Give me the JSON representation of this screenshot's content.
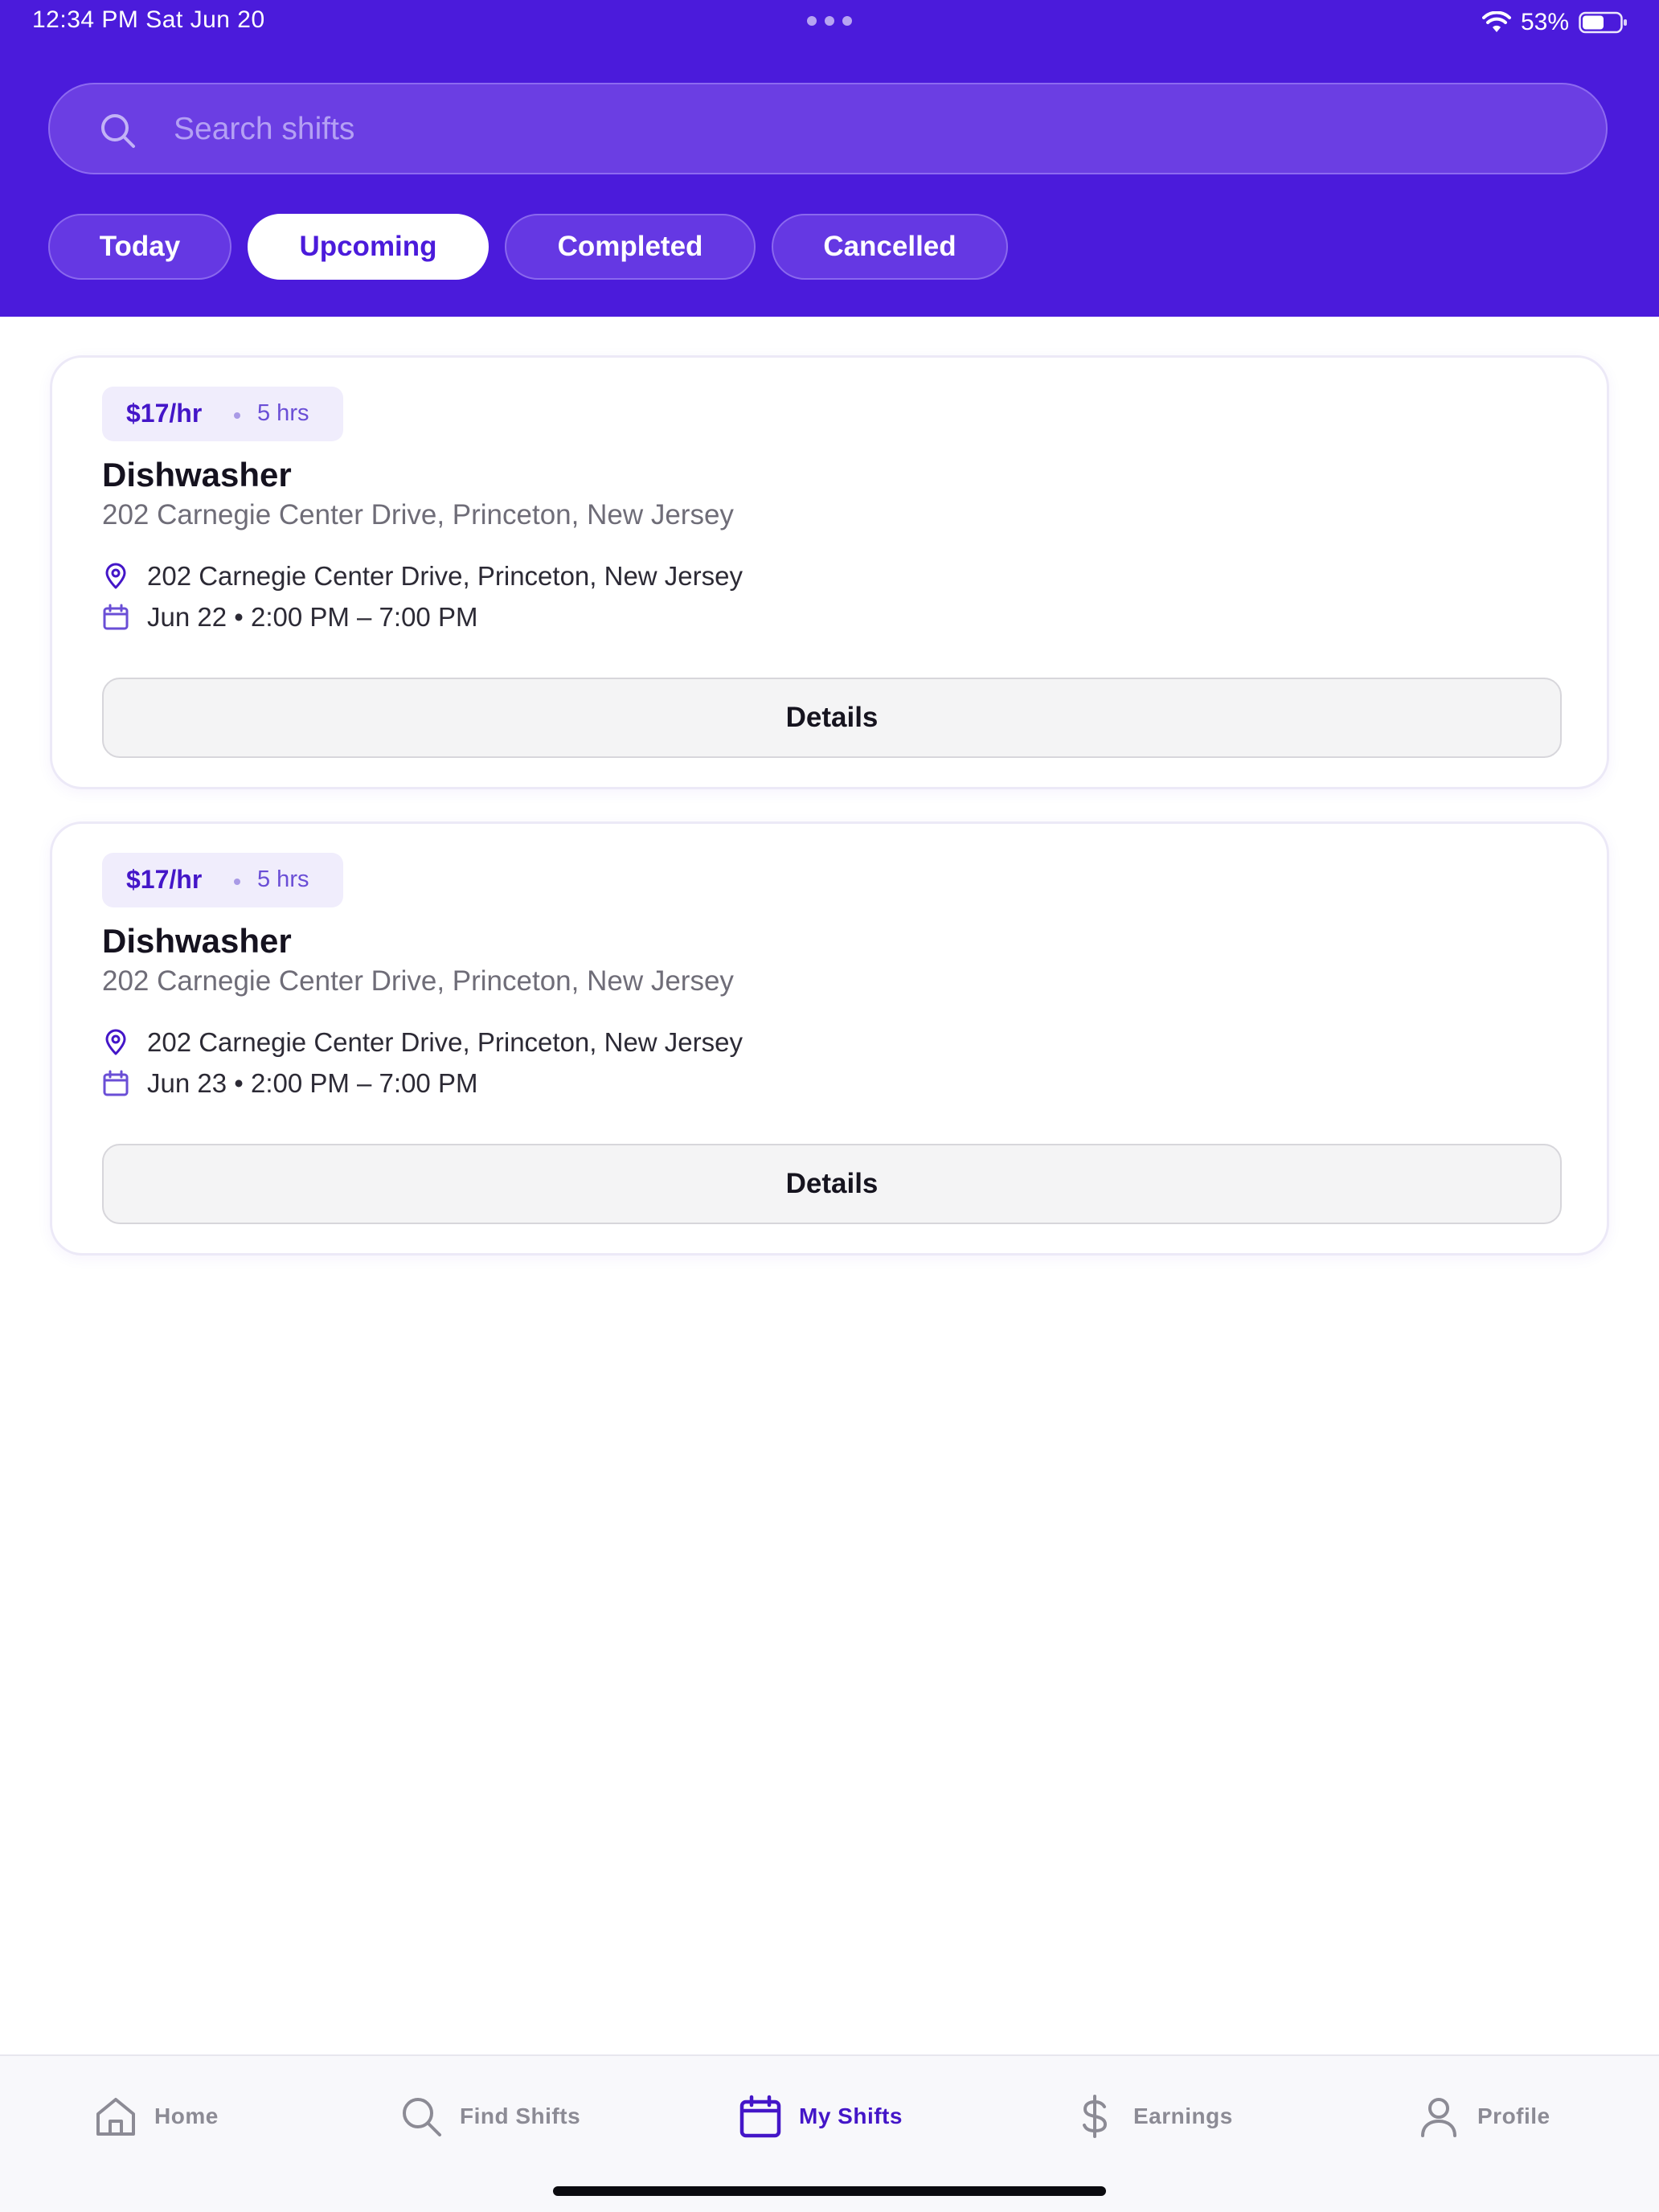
{
  "status_bar": {
    "time": "12:34 PM   Sat Jun 20",
    "battery": "53%"
  },
  "search": {
    "placeholder": "Search shifts"
  },
  "filters": [
    {
      "label": "Today",
      "active": false
    },
    {
      "label": "Upcoming",
      "active": true
    },
    {
      "label": "Completed",
      "active": false
    },
    {
      "label": "Cancelled",
      "active": false
    }
  ],
  "shifts": [
    {
      "rate": "$17/hr",
      "hours": "5 hrs",
      "title": "Dishwasher",
      "subtitle": "202 Carnegie Center Drive, Princeton, New Jersey",
      "location": "202 Carnegie Center Drive, Princeton, New Jersey",
      "schedule": "Jun 22 • 2:00 PM – 7:00 PM",
      "button": "Details"
    },
    {
      "rate": "$17/hr",
      "hours": "5 hrs",
      "title": "Dishwasher",
      "subtitle": "202 Carnegie Center Drive, Princeton, New Jersey",
      "location": "202 Carnegie Center Drive, Princeton, New Jersey",
      "schedule": "Jun 23 • 2:00 PM – 7:00 PM",
      "button": "Details"
    }
  ],
  "tabs": [
    {
      "label": "Home",
      "icon": "home-icon",
      "active": false
    },
    {
      "label": "Find Shifts",
      "icon": "search-icon",
      "active": false
    },
    {
      "label": "My Shifts",
      "icon": "calendar-icon",
      "active": true
    },
    {
      "label": "Earnings",
      "icon": "dollar-icon",
      "active": false
    },
    {
      "label": "Profile",
      "icon": "person-icon",
      "active": false
    }
  ],
  "colors": {
    "primary": "#4b1bdb",
    "accent_text": "#4416c8",
    "tab_inactive": "#8c8b95"
  }
}
